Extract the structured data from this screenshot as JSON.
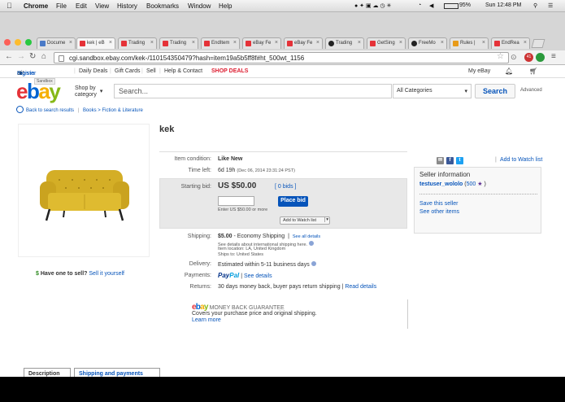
{
  "menubar": {
    "app": "Chrome",
    "items": [
      "File",
      "Edit",
      "View",
      "History",
      "Bookmarks",
      "Window",
      "Help"
    ],
    "battery": "95%",
    "clock": "Sun 12:48 PM"
  },
  "tabs": [
    {
      "label": "Docume"
    },
    {
      "label": "kek | eB"
    },
    {
      "label": "Trading"
    },
    {
      "label": "Trading"
    },
    {
      "label": "EndItem"
    },
    {
      "label": "eBay Fe"
    },
    {
      "label": "eBay Fe"
    },
    {
      "label": "Trading"
    },
    {
      "label": "GetSing"
    },
    {
      "label": "FreeMo"
    },
    {
      "label": "Rules |"
    },
    {
      "label": "EndRea"
    }
  ],
  "toolbar": {
    "url": "cgi.sandbox.ebay.com/kek-/110154350479?hash=item19a5b5ff8f#ht_500wt_1156",
    "ext_badge": "41"
  },
  "topnav": {
    "signin_prefix": "Hi!",
    "signin": "Sign in",
    "or": "or",
    "register": "register",
    "daily_deals": "Daily Deals",
    "gift_cards": "Gift Cards",
    "sell": "Sell",
    "help": "Help & Contact",
    "shop_deals": "SHOP DEALS",
    "my_ebay": "My eBay"
  },
  "header": {
    "sandbox": "Sandbox",
    "shop_by_1": "Shop by",
    "shop_by_2": "category",
    "search_placeholder": "Search...",
    "category": "All Categories",
    "search_button": "Search",
    "advanced": "Advanced"
  },
  "breadcrumb": {
    "back": "Back to search results",
    "path": "Books > Fiction & Literature"
  },
  "item": {
    "title": "kek",
    "condition_label": "Item condition:",
    "condition": "Like New",
    "time_label": "Time left:",
    "time_left": "6d 19h",
    "time_end": "(Dec 06, 2014  23:31:24 PST)",
    "bid_label": "Starting bid:",
    "price": "US $50.00",
    "bids": "[ 0 bids ]",
    "place_bid": "Place bid",
    "bid_hint": "Enter US $50.00 or more",
    "add_watch": "Add to Watch list",
    "shipping_label": "Shipping:",
    "shipping_cost": "$5.00",
    "shipping_method": "- Economy Shipping",
    "see_all": "See all details",
    "ship_intl": "See details about international shipping here.",
    "item_location": "Item location: LA, United Kingdom",
    "ships_to": "Ships to: United States",
    "delivery_label": "Delivery:",
    "delivery": "Estimated within 5-11 business days",
    "payments_label": "Payments:",
    "paypal_1": "Pay",
    "paypal_2": "Pal",
    "see_details": "See details",
    "returns_label": "Returns:",
    "returns": "30 days money back, buyer pays return shipping",
    "read_details": "Read details"
  },
  "seller": {
    "watch_link": "Add to Watch list",
    "heading": "Seller information",
    "name": "testuser_wololo",
    "feedback_open": "(",
    "feedback": "500",
    "feedback_close": ")",
    "save": "Save this seller",
    "other": "See other items"
  },
  "sell_yours": {
    "dollar": "$",
    "question": "Have one to sell?",
    "link": "Sell it yourself"
  },
  "guarantee": {
    "logo": "ebay",
    "title": "MONEY BACK GUARANTEE",
    "desc": "Covers your purchase price and original shipping.",
    "learn": "Learn more"
  },
  "bottom_tabs": {
    "description": "Description",
    "shipping": "Shipping and payments"
  },
  "colors": {
    "ebay_red": "#e53238",
    "ebay_blue": "#0064d2",
    "ebay_yellow": "#f5af02",
    "ebay_green": "#86b817",
    "link": "#0654ba",
    "bid_button": "#0654ba",
    "sofa": "#d9b52a"
  },
  "icons": [
    "apple-icon",
    "back-arrow-icon",
    "forward-arrow-icon",
    "reload-icon",
    "home-icon",
    "star-icon",
    "menu-icon",
    "bell-icon",
    "cart-icon",
    "wifi-icon",
    "search-icon",
    "email-share-icon",
    "facebook-icon",
    "twitter-icon",
    "info-icon",
    "seller-star-icon"
  ]
}
